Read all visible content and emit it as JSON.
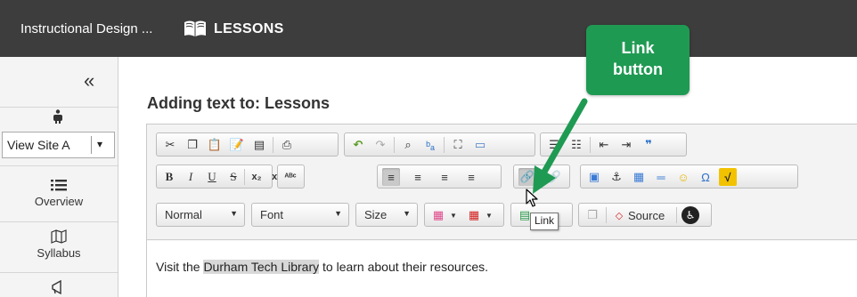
{
  "header": {
    "site_title": "Instructional Design ...",
    "section_title": "LESSONS"
  },
  "sidebar": {
    "collapse_glyph": "«",
    "view_site": {
      "label": "View Site A",
      "caret": "▾"
    },
    "nav": [
      {
        "label": "Overview",
        "icon": "list-icon"
      },
      {
        "label": "Syllabus",
        "icon": "map-icon"
      },
      {
        "label": "",
        "icon": "megaphone-icon"
      }
    ]
  },
  "main": {
    "heading": "Adding text to: Lessons",
    "toolbar": {
      "format_combo": "Normal",
      "font_combo": "Font",
      "size_combo": "Size",
      "source_label": "Source",
      "combo_caret": "▼"
    },
    "editor_text": {
      "before": "Visit the ",
      "link": "Durham Tech Library",
      "after": " to learn about their resources."
    },
    "tooltip": "Link"
  },
  "annotation": {
    "line1": "Link",
    "line2": "button",
    "color": "#1f9a53"
  }
}
